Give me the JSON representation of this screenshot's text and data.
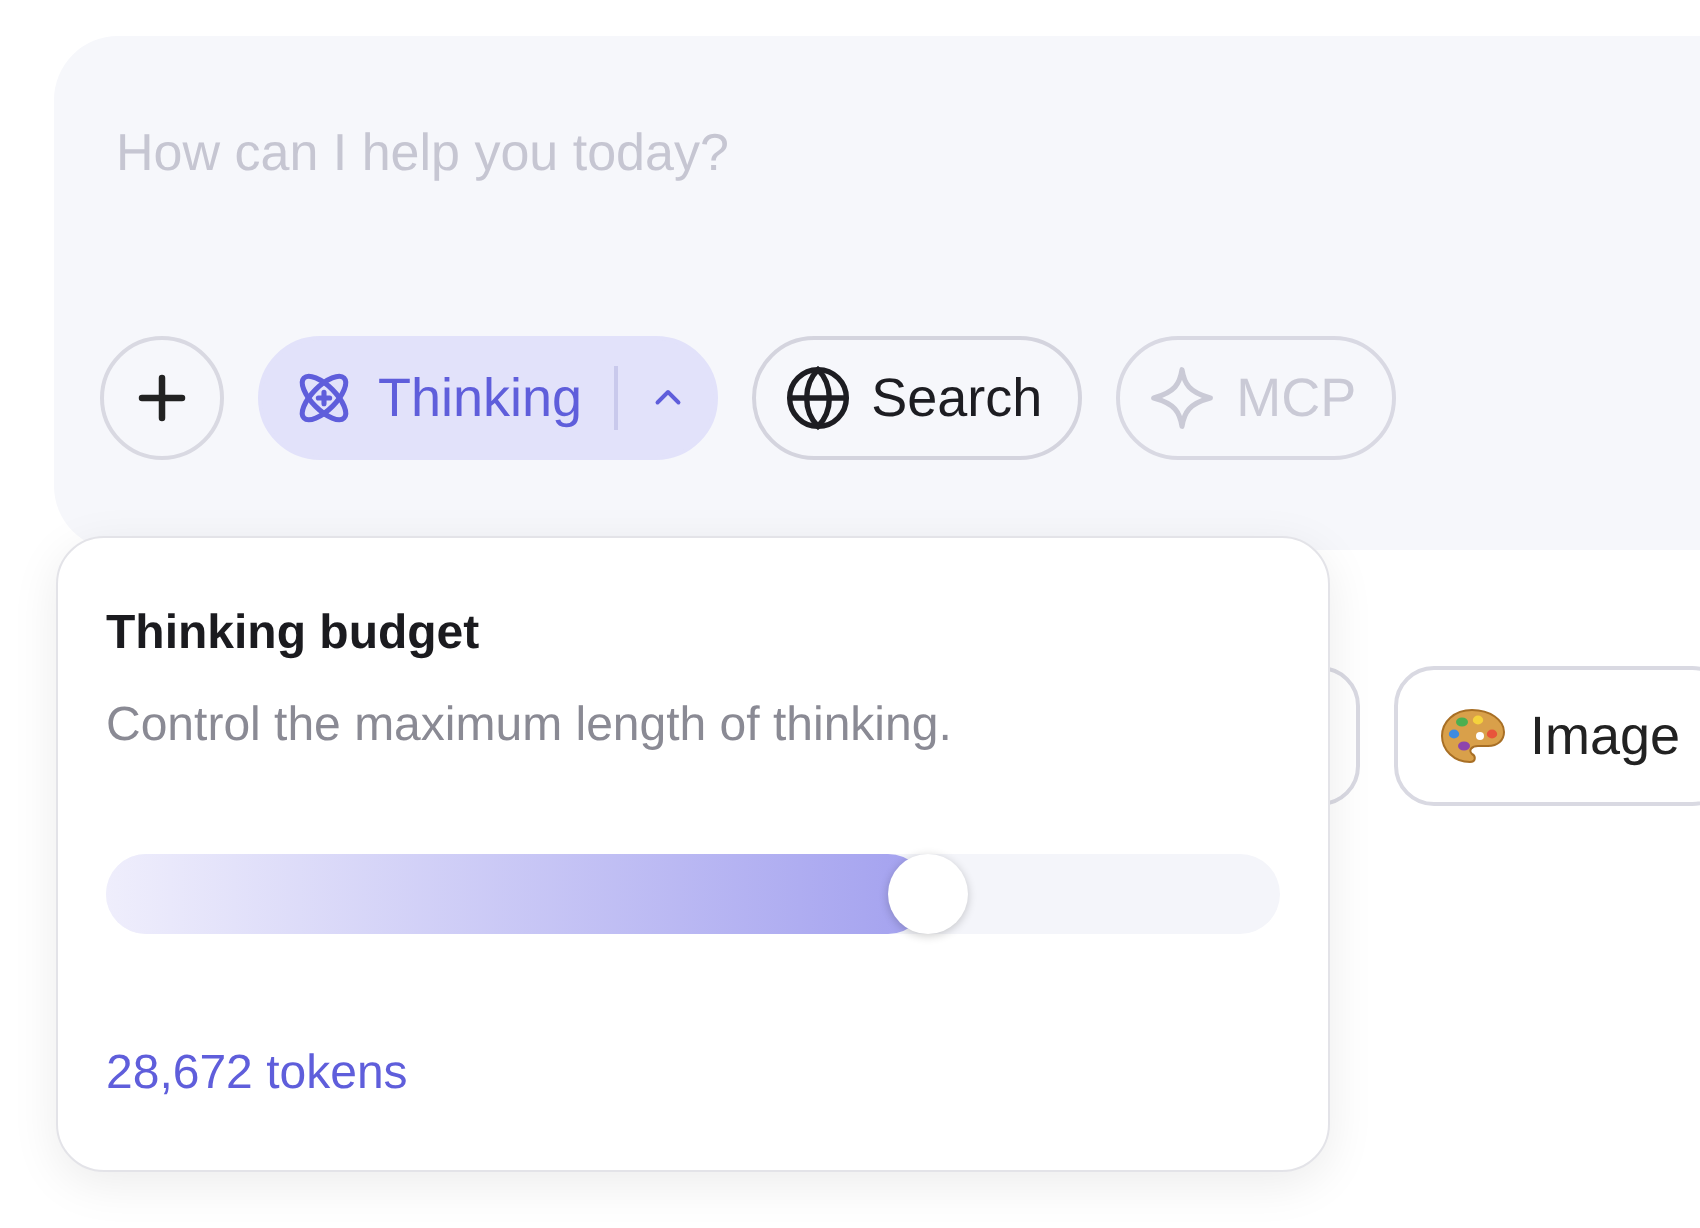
{
  "composer": {
    "placeholder": "How can I help you today?",
    "toolbar": [
      {
        "kind": "add",
        "selected": false,
        "disabled": false
      },
      {
        "kind": "thinking",
        "label": "Thinking",
        "selected": true,
        "disabled": false,
        "expanded": true
      },
      {
        "kind": "search",
        "label": "Search",
        "selected": false,
        "disabled": false
      },
      {
        "kind": "mcp",
        "label": "MCP",
        "selected": false,
        "disabled": true
      }
    ]
  },
  "suggestions": [
    {
      "kind": "covered"
    },
    {
      "kind": "image",
      "label": "Image"
    }
  ],
  "thinking_popover": {
    "title": "Thinking budget",
    "description": "Control the maximum length of thinking.",
    "slider": {
      "level": 0.714
    },
    "reading": "28,672 tokens"
  }
}
